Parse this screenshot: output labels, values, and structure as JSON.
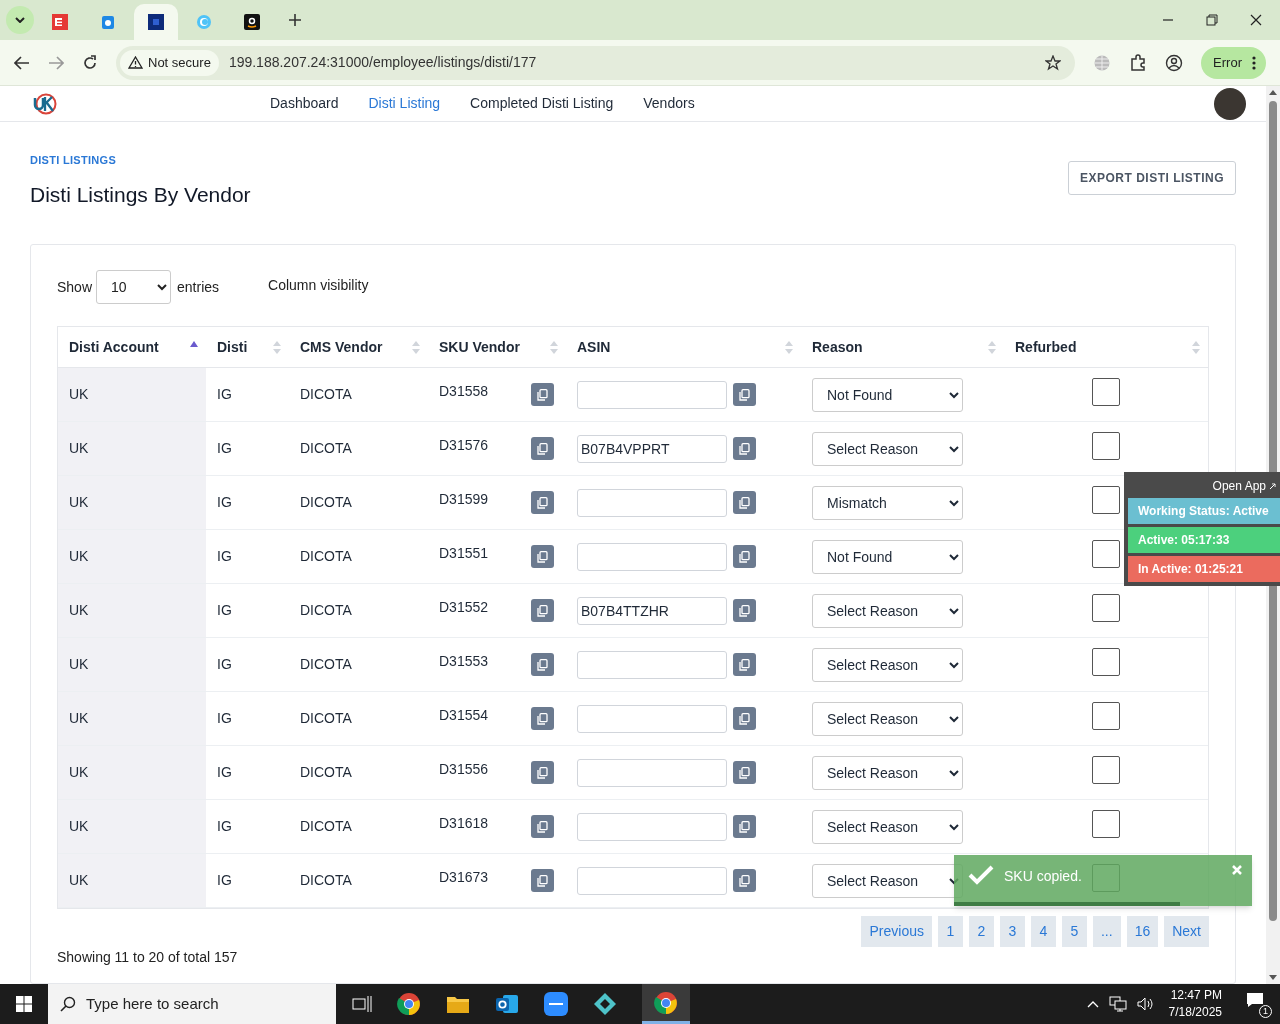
{
  "browser": {
    "tabs": [
      {
        "selected": false
      },
      {
        "selected": false
      },
      {
        "selected": true
      },
      {
        "selected": false
      },
      {
        "selected": false
      }
    ],
    "security": "Not secure",
    "url": "199.188.207.24:31000/employee/listings/disti/177",
    "profile_button": "Error"
  },
  "nav": {
    "items": [
      {
        "label": "Dashboard",
        "selected": false
      },
      {
        "label": "Disti Listing",
        "selected": true
      },
      {
        "label": "Completed Disti Listing",
        "selected": false
      },
      {
        "label": "Vendors",
        "selected": false
      }
    ]
  },
  "page": {
    "breadcrumb": "DISTI LISTINGS",
    "title": "Disti Listings By Vendor",
    "export_button": "EXPORT DISTI LISTING"
  },
  "table_controls": {
    "show_label": "Show",
    "page_size": "10",
    "entries_label": "entries",
    "column_visibility": "Column visibility"
  },
  "table": {
    "columns": [
      {
        "label": "Disti Account",
        "sorted": true
      },
      {
        "label": "Disti",
        "sorted": false
      },
      {
        "label": "CMS Vendor",
        "sorted": false
      },
      {
        "label": "SKU Vendor",
        "sorted": false
      },
      {
        "label": "ASIN",
        "sorted": false
      },
      {
        "label": "Reason",
        "sorted": false
      },
      {
        "label": "Refurbed",
        "sorted": false
      }
    ],
    "rows": [
      {
        "disti_account": "UK",
        "disti": "IG",
        "cms_vendor": "DICOTA",
        "sku_vendor": "D31558",
        "reason": "Not Found",
        "refurbed": false
      },
      {
        "disti_account": "UK",
        "disti": "IG",
        "cms_vendor": "DICOTA",
        "sku_vendor": "D31576",
        "asin": "B07B4VPPRT",
        "reason": "Select Reason",
        "refurbed": false
      },
      {
        "disti_account": "UK",
        "disti": "IG",
        "cms_vendor": "DICOTA",
        "sku_vendor": "D31599",
        "reason": "Mismatch",
        "refurbed": false
      },
      {
        "disti_account": "UK",
        "disti": "IG",
        "cms_vendor": "DICOTA",
        "sku_vendor": "D31551",
        "reason": "Not Found",
        "refurbed": false
      },
      {
        "disti_account": "UK",
        "disti": "IG",
        "cms_vendor": "DICOTA",
        "sku_vendor": "D31552",
        "asin": "B07B4TTZHR",
        "reason": "Select Reason",
        "refurbed": false
      },
      {
        "disti_account": "UK",
        "disti": "IG",
        "cms_vendor": "DICOTA",
        "sku_vendor": "D31553",
        "reason": "Select Reason",
        "refurbed": false
      },
      {
        "disti_account": "UK",
        "disti": "IG",
        "cms_vendor": "DICOTA",
        "sku_vendor": "D31554",
        "reason": "Select Reason",
        "refurbed": false
      },
      {
        "disti_account": "UK",
        "disti": "IG",
        "cms_vendor": "DICOTA",
        "sku_vendor": "D31556",
        "reason": "Select Reason",
        "refurbed": false
      },
      {
        "disti_account": "UK",
        "disti": "IG",
        "cms_vendor": "DICOTA",
        "sku_vendor": "D31618",
        "reason": "Select Reason",
        "refurbed": false
      },
      {
        "disti_account": "UK",
        "disti": "IG",
        "cms_vendor": "DICOTA",
        "sku_vendor": "D31673",
        "reason": "Select Reason",
        "refurbed": false
      }
    ]
  },
  "footer": {
    "info": "Showing 11 to 20 of total 157",
    "pagination": [
      "Previous",
      "1",
      "2",
      "3",
      "4",
      "5",
      "...",
      "16",
      "Next"
    ]
  },
  "status_widget": {
    "open_app": "Open App",
    "working_status": "Working Status: Active",
    "active": "Active: 05:17:33",
    "inactive": "In Active: 01:25:21"
  },
  "toast": {
    "message": "SKU copied.",
    "level": 0.76
  },
  "taskbar": {
    "search_placeholder": "Type here to search",
    "time": "12:47 PM",
    "date": "7/18/2025",
    "notification_count": "1"
  }
}
